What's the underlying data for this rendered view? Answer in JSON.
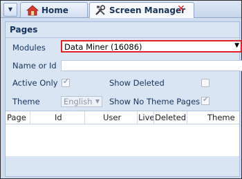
{
  "tabs": {
    "menu_glyph": "▼",
    "home_label": "Home",
    "screen_label": "Screen Manager",
    "close_glyph": "✕"
  },
  "panel": {
    "title": "Pages"
  },
  "form": {
    "modules_label": "Modules",
    "modules_value": "Data Miner (16086)",
    "name_label": "Name or Id",
    "name_value": "",
    "active_only_label": "Active Only",
    "active_only_checked": true,
    "show_deleted_label": "Show Deleted",
    "show_deleted_checked": false,
    "theme_label": "Theme",
    "theme_value": "English",
    "show_no_theme_label": "Show No Theme Pages",
    "show_no_theme_checked": true
  },
  "grid": {
    "columns": [
      "Page",
      "Id",
      "User",
      "Live",
      "Deleted",
      "Theme"
    ],
    "rows": []
  },
  "colors": {
    "accent_border": "#e0202a",
    "close": "#d1202f"
  }
}
